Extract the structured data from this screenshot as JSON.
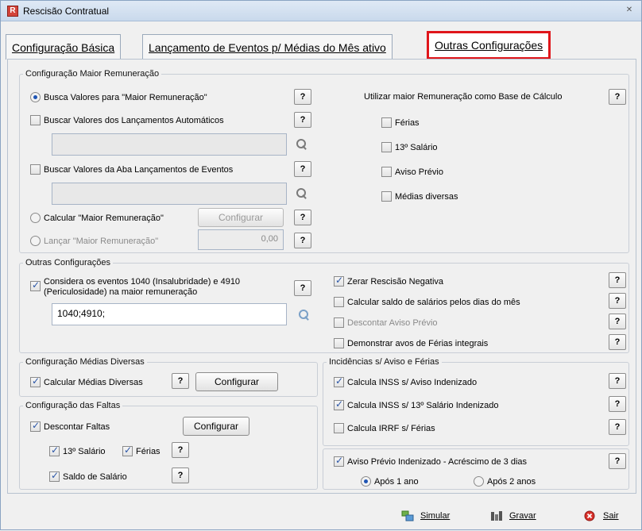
{
  "window": {
    "title": "Rescisão Contratual",
    "close": "✕",
    "icon_letter": "R"
  },
  "tabs": [
    {
      "label": "Configuração Básica"
    },
    {
      "label": "Lançamento de Eventos p/ Médias do Mês ativo"
    },
    {
      "label": "Outras Configurações"
    }
  ],
  "maior_remuneracao": {
    "legend": "Configuração Maior Remuneração",
    "busca_valores": "Busca Valores para \"Maior Remuneração\"",
    "buscar_lancamentos": "Buscar Valores dos Lançamentos Automáticos",
    "buscar_aba": "Buscar Valores da Aba Lançamentos de Eventos",
    "calcular": "Calcular \"Maior Remuneração\"",
    "configurar": "Configurar",
    "lancar": "Lançar \"Maior Remuneração\"",
    "lancar_value": "0,00",
    "utilizar_label": "Utilizar maior Remuneração como Base de Cálculo",
    "base_options": [
      "Férias",
      "13º Salário",
      "Aviso Prévio",
      "Médias diversas"
    ]
  },
  "outras": {
    "legend": "Outras Configurações",
    "considera_line1": "Considera os eventos 1040 (Insalubridade) e 4910",
    "considera_line2": "(Periculosidade) na maior remuneração",
    "eventos_value": "1040;4910;",
    "zerar": "Zerar Rescisão Negativa",
    "calcular_saldo": "Calcular saldo de salários pelos dias do mês",
    "descontar_aviso": "Descontar Aviso Prévio",
    "demonstrar": "Demonstrar avos de Férias integrais"
  },
  "medias": {
    "legend": "Configuração Médias Diversas",
    "calcular": "Calcular Médias Diversas",
    "configurar": "Configurar"
  },
  "faltas": {
    "legend": "Configuração das Faltas",
    "descontar": "Descontar Faltas",
    "configurar": "Configurar",
    "decimo": "13º Salário",
    "ferias": "Férias",
    "saldo": "Saldo de Salário"
  },
  "incidencias": {
    "legend": "Incidências s/ Aviso e Férias",
    "inss_aviso": "Calcula INSS s/ Aviso Indenizado",
    "inss_13": "Calcula INSS s/ 13º Salário Indenizado",
    "irrf": "Calcula IRRF s/ Férias"
  },
  "aviso": {
    "label": "Aviso Prévio Indenizado - Acréscimo de 3 dias",
    "apos1": "Após 1 ano",
    "apos2": "Após 2 anos"
  },
  "help": "?",
  "footer": {
    "simular": "Simular",
    "gravar": "Gravar",
    "sair": "Sair"
  },
  "colors": {
    "tab_highlight": "#e0161b",
    "accent": "#1f55b4"
  }
}
